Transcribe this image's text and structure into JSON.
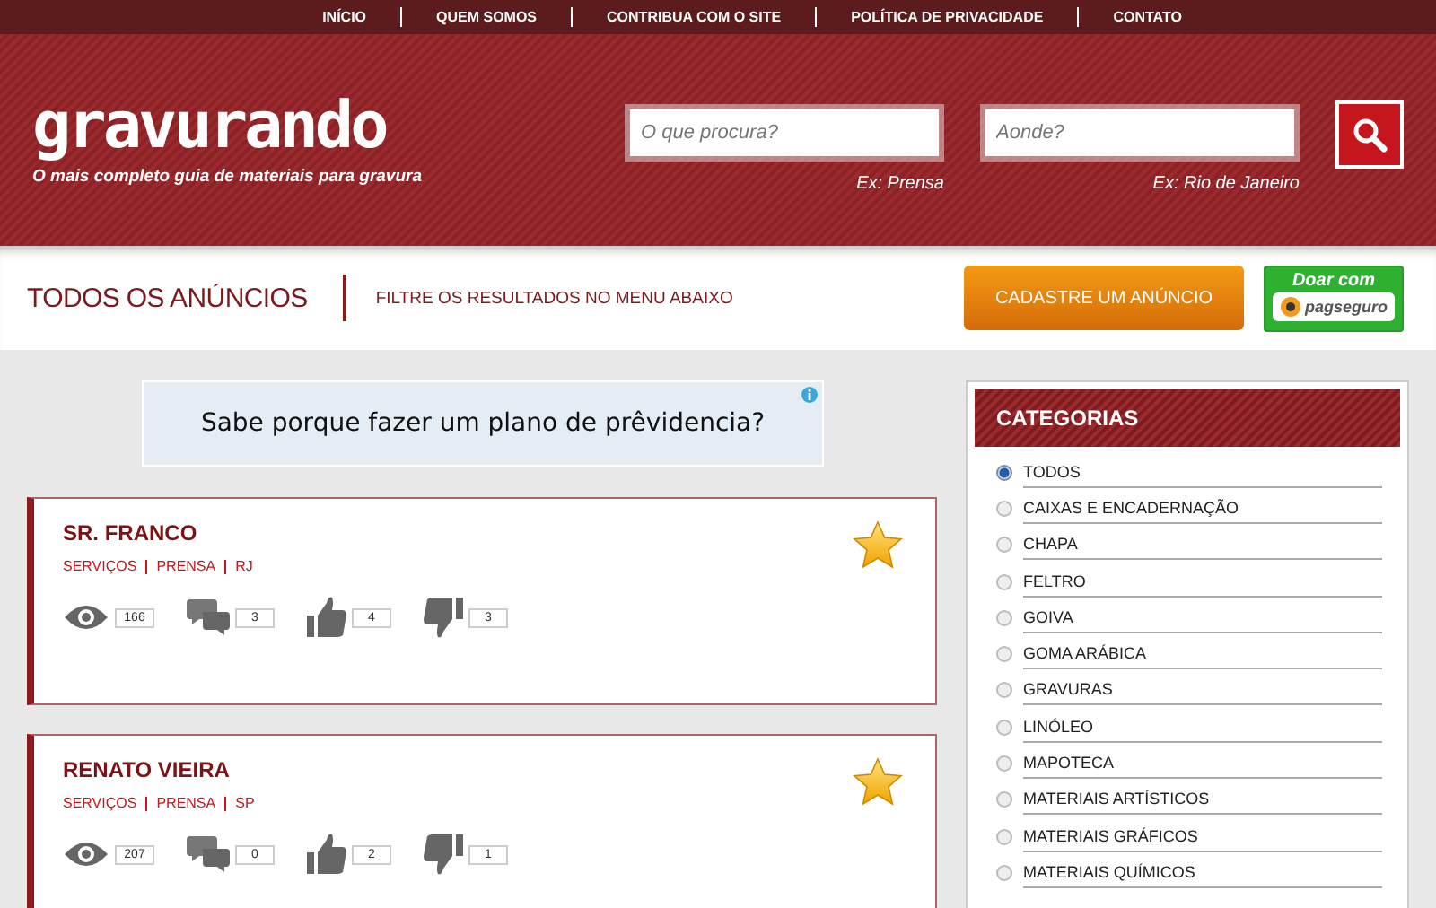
{
  "top_nav": [
    {
      "label": "INÍCIO"
    },
    {
      "label": "QUEM SOMOS"
    },
    {
      "label": "CONTRIBUA COM O SITE"
    },
    {
      "label": "POLÍTICA DE PRIVACIDADE"
    },
    {
      "label": "CONTATO"
    }
  ],
  "header": {
    "logo": "gravurando",
    "tagline": "O mais completo guia de materiais para gravura",
    "search": [
      {
        "placeholder": "O que procura?",
        "hint": "Ex: Prensa"
      },
      {
        "placeholder": "Aonde?",
        "hint": "Ex: Rio de Janeiro"
      }
    ]
  },
  "subheader": {
    "title": "TODOS OS ANÚNCIOS",
    "filter_text": "FILTRE OS RESULTADOS NO MENU ABAIXO",
    "register_button": "CADASTRE UM ANÚNCIO",
    "donate": {
      "label": "Doar com",
      "brand": "pagseguro"
    }
  },
  "ad": {
    "text": "Sabe porque fazer um plano de prêvidencia?"
  },
  "listings": [
    {
      "name": "SR. FRANCO",
      "tags": [
        "SERVIÇOS",
        "PRENSA",
        "RJ"
      ],
      "views": "166",
      "comments": "3",
      "likes": "4",
      "dislikes": "3",
      "featured": true
    },
    {
      "name": "RENATO VIEIRA",
      "tags": [
        "SERVIÇOS",
        "PRENSA",
        "SP"
      ],
      "views": "207",
      "comments": "0",
      "likes": "2",
      "dislikes": "1",
      "featured": true
    }
  ],
  "categories": {
    "title": "CATEGORIAS",
    "items": [
      {
        "label": "TODOS",
        "selected": true
      },
      {
        "label": "CAIXAS E ENCADERNAÇÃO",
        "selected": false
      },
      {
        "label": "CHAPA",
        "selected": false
      },
      {
        "label": "FELTRO",
        "selected": false
      },
      {
        "label": "GOIVA",
        "selected": false
      },
      {
        "label": "GOMA ARÁBICA",
        "selected": false
      },
      {
        "label": "GRAVURAS",
        "selected": false
      },
      {
        "label": "LINÓLEO",
        "selected": false
      },
      {
        "label": "MAPOTECA",
        "selected": false
      },
      {
        "label": "MATERIAIS ARTÍSTICOS",
        "selected": false
      },
      {
        "label": "MATERIAIS GRÁFICOS",
        "selected": false
      },
      {
        "label": "MATERIAIS QUÍMICOS",
        "selected": false
      }
    ]
  }
}
